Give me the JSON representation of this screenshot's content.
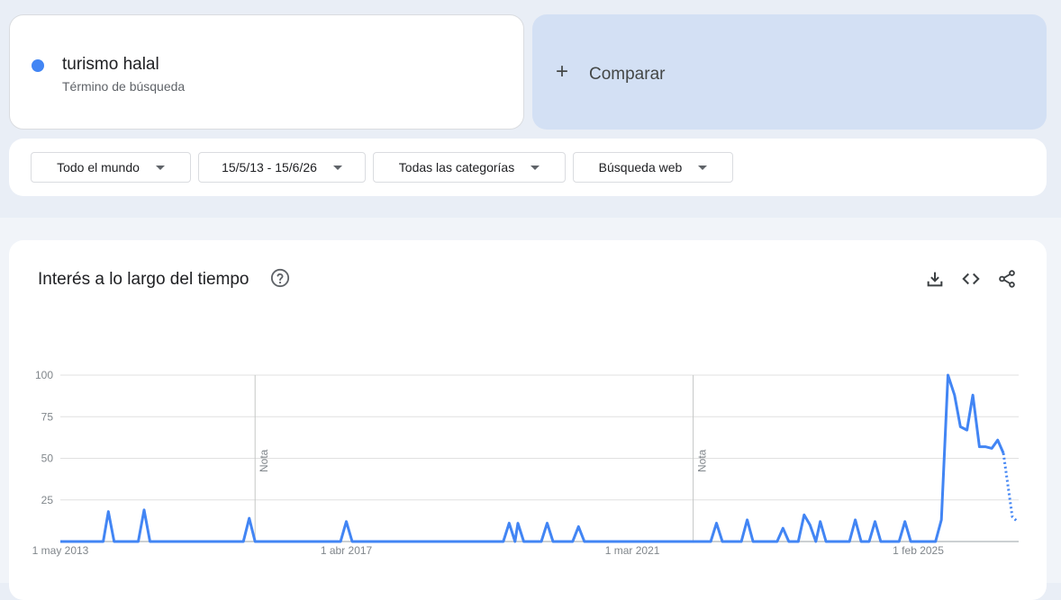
{
  "term": {
    "name": "turismo halal",
    "type": "Término de búsqueda",
    "color": "#4285f4"
  },
  "compare": {
    "label": "Comparar"
  },
  "filters": {
    "region": "Todo el mundo",
    "date_range": "15/5/13 - 15/6/26",
    "category": "Todas las categorías",
    "search_type": "Búsqueda web"
  },
  "chart": {
    "title": "Interés a lo largo del tiempo",
    "note_label": "Nota"
  },
  "toolbar": {
    "icons": [
      "download-icon",
      "embed-code-icon",
      "share-icon"
    ]
  },
  "chart_data": {
    "type": "line",
    "series": [
      {
        "name": "turismo halal",
        "color": "#4285f4"
      }
    ],
    "y_ticks": [
      100,
      75,
      50,
      25
    ],
    "ylim": [
      0,
      100
    ],
    "x_tick_labels": [
      "1 may 2013",
      "1 abr 2017",
      "1 mar 2021",
      "1 feb 2025"
    ],
    "x_ticks": [
      2013.333,
      2017.25,
      2021.167,
      2025.083
    ],
    "xlim": [
      2013.333,
      2026.458
    ],
    "notes_at": [
      2016.0,
      2022.0
    ],
    "points": [
      [
        2013.333,
        0
      ],
      [
        2013.92,
        0
      ],
      [
        2013.99,
        18
      ],
      [
        2014.07,
        0
      ],
      [
        2014.4,
        0
      ],
      [
        2014.48,
        19
      ],
      [
        2014.56,
        0
      ],
      [
        2015.84,
        0
      ],
      [
        2015.92,
        14
      ],
      [
        2016.0,
        0
      ],
      [
        2017.17,
        0
      ],
      [
        2017.25,
        12
      ],
      [
        2017.33,
        0
      ],
      [
        2019.4,
        0
      ],
      [
        2019.48,
        11
      ],
      [
        2019.56,
        0
      ],
      [
        2019.6,
        11
      ],
      [
        2019.68,
        0
      ],
      [
        2019.92,
        0
      ],
      [
        2020.0,
        11
      ],
      [
        2020.08,
        0
      ],
      [
        2020.35,
        0
      ],
      [
        2020.43,
        9
      ],
      [
        2020.51,
        0
      ],
      [
        2022.24,
        0
      ],
      [
        2022.32,
        11
      ],
      [
        2022.4,
        0
      ],
      [
        2022.66,
        0
      ],
      [
        2022.74,
        13
      ],
      [
        2022.82,
        0
      ],
      [
        2023.15,
        0
      ],
      [
        2023.23,
        8
      ],
      [
        2023.31,
        0
      ],
      [
        2023.44,
        0
      ],
      [
        2023.52,
        16
      ],
      [
        2023.6,
        10
      ],
      [
        2023.68,
        0
      ],
      [
        2023.74,
        12
      ],
      [
        2023.82,
        0
      ],
      [
        2024.14,
        0
      ],
      [
        2024.22,
        13
      ],
      [
        2024.3,
        0
      ],
      [
        2024.41,
        0
      ],
      [
        2024.49,
        12
      ],
      [
        2024.57,
        0
      ],
      [
        2024.82,
        0
      ],
      [
        2024.9,
        12
      ],
      [
        2024.98,
        0
      ],
      [
        2025.32,
        0
      ],
      [
        2025.4,
        13
      ],
      [
        2025.49,
        100
      ],
      [
        2025.58,
        88
      ],
      [
        2025.66,
        69
      ],
      [
        2025.75,
        67
      ],
      [
        2025.83,
        88
      ],
      [
        2025.92,
        57
      ],
      [
        2026.0,
        57
      ],
      [
        2026.09,
        56
      ],
      [
        2026.17,
        61
      ],
      [
        2026.25,
        53
      ]
    ],
    "partial_points": [
      [
        2026.25,
        53
      ],
      [
        2026.37,
        15
      ],
      [
        2026.44,
        12
      ]
    ]
  }
}
